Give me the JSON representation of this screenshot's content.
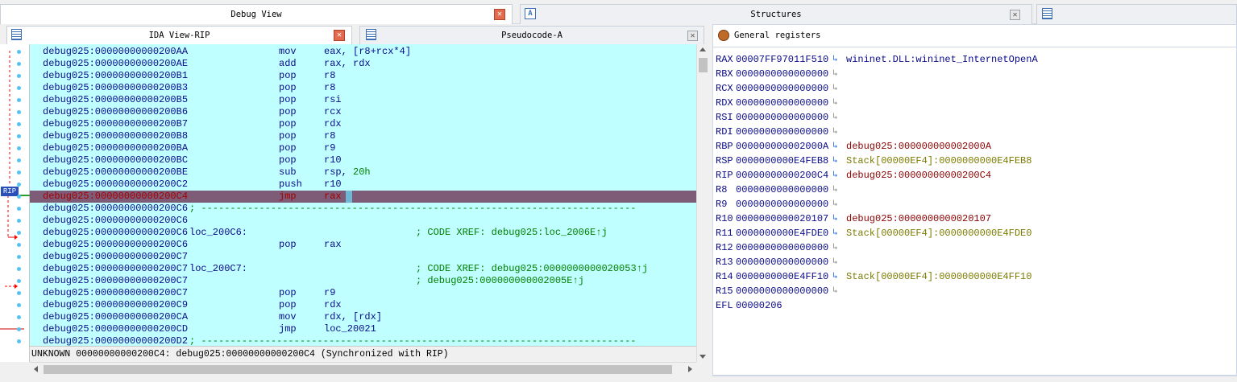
{
  "tabs_top": [
    {
      "label": "Debug View",
      "active": true
    },
    {
      "label": "Structures",
      "active": false
    }
  ],
  "tabs_sub": [
    {
      "label": "IDA View-RIP",
      "active": true
    },
    {
      "label": "Pseudocode-A",
      "active": false
    }
  ],
  "gutter": {
    "rip_label": "RIP"
  },
  "listing": [
    {
      "addr": "debug025:00000000000200AA",
      "label": "",
      "mn": "mov",
      "op": "eax, [r8+rcx*4]",
      "cmt": ""
    },
    {
      "addr": "debug025:00000000000200AE",
      "label": "",
      "mn": "add",
      "op": "rax, rdx",
      "cmt": ""
    },
    {
      "addr": "debug025:00000000000200B1",
      "label": "",
      "mn": "pop",
      "op": "r8",
      "cmt": ""
    },
    {
      "addr": "debug025:00000000000200B3",
      "label": "",
      "mn": "pop",
      "op": "r8",
      "cmt": ""
    },
    {
      "addr": "debug025:00000000000200B5",
      "label": "",
      "mn": "pop",
      "op": "rsi",
      "cmt": ""
    },
    {
      "addr": "debug025:00000000000200B6",
      "label": "",
      "mn": "pop",
      "op": "rcx",
      "cmt": ""
    },
    {
      "addr": "debug025:00000000000200B7",
      "label": "",
      "mn": "pop",
      "op": "rdx",
      "cmt": ""
    },
    {
      "addr": "debug025:00000000000200B8",
      "label": "",
      "mn": "pop",
      "op": "r8",
      "cmt": ""
    },
    {
      "addr": "debug025:00000000000200BA",
      "label": "",
      "mn": "pop",
      "op": "r9",
      "cmt": ""
    },
    {
      "addr": "debug025:00000000000200BC",
      "label": "",
      "mn": "pop",
      "op": "r10",
      "cmt": ""
    },
    {
      "addr": "debug025:00000000000200BE",
      "label": "",
      "mn": "sub",
      "op": "rsp, ",
      "opnum": "20h",
      "cmt": ""
    },
    {
      "addr": "debug025:00000000000200C2",
      "label": "",
      "mn": "push",
      "op": "r10",
      "cmt": ""
    },
    {
      "addr": "debug025:00000000000200C4",
      "label": "",
      "mn": "jmp",
      "op": "rax",
      "cmt": "",
      "current": true
    },
    {
      "addr": "debug025:00000000000200C6",
      "label": "",
      "mn": "",
      "op": "",
      "cmt": "",
      "sep": "; ---------------------------------------------------------------------------"
    },
    {
      "addr": "debug025:00000000000200C6",
      "label": "",
      "mn": "",
      "op": "",
      "cmt": ""
    },
    {
      "addr": "debug025:00000000000200C6",
      "label": "loc_200C6:",
      "mn": "",
      "op": "",
      "cmt": "; CODE XREF: debug025:loc_2006E↑j"
    },
    {
      "addr": "debug025:00000000000200C6",
      "label": "",
      "mn": "pop",
      "op": "rax",
      "cmt": ""
    },
    {
      "addr": "debug025:00000000000200C7",
      "label": "",
      "mn": "",
      "op": "",
      "cmt": ""
    },
    {
      "addr": "debug025:00000000000200C7",
      "label": "loc_200C7:",
      "mn": "",
      "op": "",
      "cmt": "; CODE XREF: debug025:0000000000020053↑j"
    },
    {
      "addr": "debug025:00000000000200C7",
      "label": "",
      "mn": "",
      "op": "",
      "cmt": "; debug025:000000000002005E↑j"
    },
    {
      "addr": "debug025:00000000000200C7",
      "label": "",
      "mn": "pop",
      "op": "r9",
      "cmt": ""
    },
    {
      "addr": "debug025:00000000000200C9",
      "label": "",
      "mn": "pop",
      "op": "rdx",
      "cmt": ""
    },
    {
      "addr": "debug025:00000000000200CA",
      "label": "",
      "mn": "mov",
      "op": "rdx, [rdx]",
      "cmt": ""
    },
    {
      "addr": "debug025:00000000000200CD",
      "label": "",
      "mn": "jmp",
      "op": "loc_20021",
      "cmt": ""
    },
    {
      "addr": "debug025:00000000000200D2",
      "label": "",
      "mn": "",
      "op": "",
      "cmt": "",
      "sep": "; ---------------------------------------------------------------------------"
    }
  ],
  "status_text": "UNKNOWN 00000000000200C4: debug025:00000000000200C4 (Synchronized with RIP)",
  "registers_panel": {
    "title": "General registers"
  },
  "registers": [
    {
      "name": "RAX",
      "value": "00007FF97011F510",
      "arrow": "↳",
      "arrow_active": true,
      "target": "wininet.DLL:wininet_InternetOpenA",
      "target_color": "blue"
    },
    {
      "name": "RBX",
      "value": "0000000000000000",
      "arrow": "↳",
      "arrow_active": false,
      "target": ""
    },
    {
      "name": "RCX",
      "value": "0000000000000000",
      "arrow": "↳",
      "arrow_active": false,
      "target": ""
    },
    {
      "name": "RDX",
      "value": "0000000000000000",
      "arrow": "↳",
      "arrow_active": false,
      "target": ""
    },
    {
      "name": "RSI",
      "value": "0000000000000000",
      "arrow": "↳",
      "arrow_active": false,
      "target": ""
    },
    {
      "name": "RDI",
      "value": "0000000000000000",
      "arrow": "↳",
      "arrow_active": false,
      "target": ""
    },
    {
      "name": "RBP",
      "value": "000000000002000A",
      "arrow": "↳",
      "arrow_active": true,
      "target": "debug025:000000000002000A",
      "target_color": "red"
    },
    {
      "name": "RSP",
      "value": "0000000000E4FEB8",
      "arrow": "↳",
      "arrow_active": true,
      "target": "Stack[00000EF4]:0000000000E4FEB8",
      "target_color": "olive"
    },
    {
      "name": "RIP",
      "value": "00000000000200C4",
      "arrow": "↳",
      "arrow_active": true,
      "target": "debug025:00000000000200C4",
      "target_color": "red"
    },
    {
      "name": "R8",
      "value": "0000000000000000",
      "arrow": "↳",
      "arrow_active": false,
      "target": ""
    },
    {
      "name": "R9",
      "value": "0000000000000000",
      "arrow": "↳",
      "arrow_active": false,
      "target": ""
    },
    {
      "name": "R10",
      "value": "0000000000020107",
      "arrow": "↳",
      "arrow_active": true,
      "target": "debug025:0000000000020107",
      "target_color": "red"
    },
    {
      "name": "R11",
      "value": "0000000000E4FDE0",
      "arrow": "↳",
      "arrow_active": true,
      "target": "Stack[00000EF4]:0000000000E4FDE0",
      "target_color": "olive"
    },
    {
      "name": "R12",
      "value": "0000000000000000",
      "arrow": "↳",
      "arrow_active": false,
      "target": ""
    },
    {
      "name": "R13",
      "value": "0000000000000000",
      "arrow": "↳",
      "arrow_active": false,
      "target": ""
    },
    {
      "name": "R14",
      "value": "0000000000E4FF10",
      "arrow": "↳",
      "arrow_active": true,
      "target": "Stack[00000EF4]:0000000000E4FF10",
      "target_color": "olive"
    },
    {
      "name": "R15",
      "value": "0000000000000000",
      "arrow": "↳",
      "arrow_active": false,
      "target": ""
    },
    {
      "name": "EFL",
      "value": "00000206",
      "arrow": "",
      "arrow_active": false,
      "target": ""
    }
  ],
  "colors": {
    "listing_bg": "#c0ffff",
    "current_line_bg": "#7e5b77",
    "comment": "#008000",
    "code_text": "#0a0a8a",
    "close_button": "#e36a4e"
  },
  "icons": {
    "top_tab_1": "close-icon",
    "structures_tab": "struct-icon",
    "sub_tab_1": "listing-icon",
    "sub_tab_2": "pseudocode-icon",
    "registers": "bug-icon"
  }
}
